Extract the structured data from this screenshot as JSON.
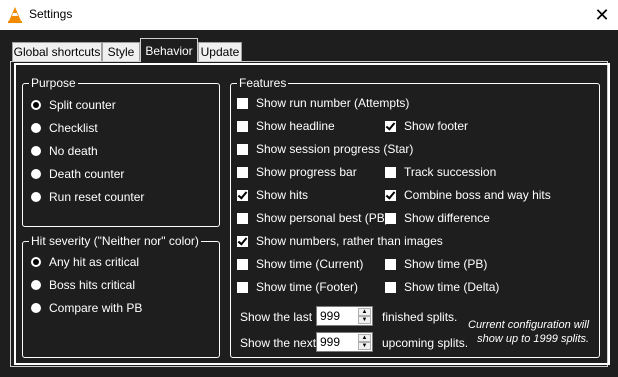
{
  "window": {
    "title": "Settings",
    "close_glyph": "✕"
  },
  "tabs": [
    {
      "label": "Global shortcuts"
    },
    {
      "label": "Style"
    },
    {
      "label": "Behavior"
    },
    {
      "label": "Update"
    }
  ],
  "active_tab": "Behavior",
  "purpose": {
    "legend": "Purpose",
    "options": [
      {
        "label": "Split counter",
        "checked": true
      },
      {
        "label": "Checklist",
        "checked": false
      },
      {
        "label": "No death",
        "checked": false
      },
      {
        "label": "Death counter",
        "checked": false
      },
      {
        "label": "Run reset counter",
        "checked": false
      }
    ]
  },
  "hit_severity": {
    "legend": "Hit severity (\"Neither nor\" color)",
    "options": [
      {
        "label": "Any hit as critical",
        "checked": true
      },
      {
        "label": "Boss hits critical",
        "checked": false
      },
      {
        "label": "Compare with PB",
        "checked": false
      }
    ]
  },
  "features": {
    "legend": "Features",
    "items": {
      "show_run_number": {
        "label": "Show run number (Attempts)",
        "checked": false
      },
      "show_headline": {
        "label": "Show headline",
        "checked": false
      },
      "show_footer": {
        "label": "Show footer",
        "checked": true
      },
      "show_session_progress": {
        "label": "Show session progress (Star)",
        "checked": false
      },
      "show_progress_bar": {
        "label": "Show progress bar",
        "checked": false
      },
      "track_succession": {
        "label": "Track succession",
        "checked": false
      },
      "show_hits": {
        "label": "Show hits",
        "checked": true
      },
      "combine_boss_way": {
        "label": "Combine boss and way hits",
        "checked": true
      },
      "show_personal_best": {
        "label": "Show personal best (PB)",
        "checked": false
      },
      "show_difference": {
        "label": "Show difference",
        "checked": false
      },
      "show_numbers": {
        "label": "Show numbers, rather than images",
        "checked": true
      },
      "show_time_current": {
        "label": "Show time (Current)",
        "checked": false
      },
      "show_time_pb": {
        "label": "Show time (PB)",
        "checked": false
      },
      "show_time_footer": {
        "label": "Show time (Footer)",
        "checked": false
      },
      "show_time_delta": {
        "label": "Show time (Delta)",
        "checked": false
      }
    },
    "last_splits": {
      "prefix": "Show the last",
      "value": "999",
      "suffix": "finished splits."
    },
    "next_splits": {
      "prefix": "Show the next",
      "value": "999",
      "suffix": "upcoming splits."
    },
    "note_line1": "Current configuration will",
    "note_line2": "show up to 1999 splits."
  },
  "icons": {
    "app": "cone-icon",
    "close": "close-icon"
  }
}
